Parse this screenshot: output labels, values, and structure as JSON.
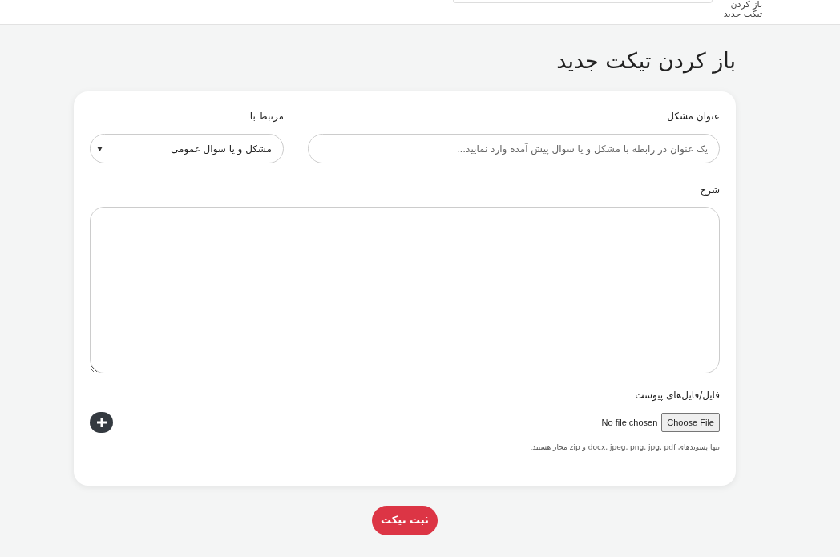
{
  "top_bar": {
    "breadcrumb": "باز کردن تیکت جدید"
  },
  "page_title": "باز کردن تیکت جدید",
  "form": {
    "subject": {
      "label": "عنوان مشکل",
      "placeholder": "یک عنوان در رابطه با مشکل و یا سوال پیش آمده وارد نمایید..."
    },
    "related": {
      "label": "مرتبط با",
      "value": "مشکل و یا سوال عمومی"
    },
    "description": {
      "label": "شرح"
    },
    "attachments": {
      "label": "فایل/فایل‌های پیوست",
      "choose_button": "Choose File",
      "status": "No file chosen",
      "hint": "تنها پسوندهای docx, jpeg, png, jpg, pdf و zip مجاز هستند."
    }
  },
  "submit_button": "ثبت تیکت"
}
